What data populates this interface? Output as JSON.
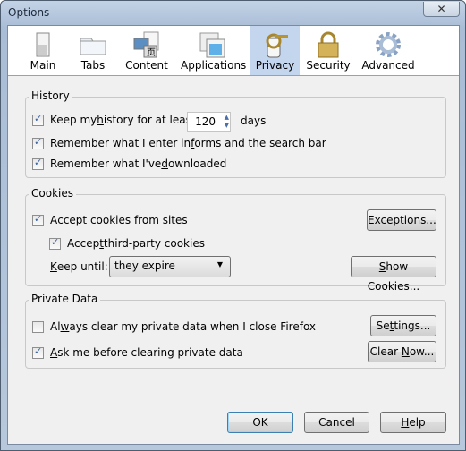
{
  "window": {
    "title": "Options",
    "close_icon": "close-icon"
  },
  "toolbar": {
    "items": [
      {
        "label": "Main",
        "icon": "switch-icon"
      },
      {
        "label": "Tabs",
        "icon": "folder-tabs-icon"
      },
      {
        "label": "Content",
        "icon": "content-icon"
      },
      {
        "label": "Applications",
        "icon": "applications-icon"
      },
      {
        "label": "Privacy",
        "icon": "privacy-key-icon",
        "selected": true
      },
      {
        "label": "Security",
        "icon": "padlock-icon"
      },
      {
        "label": "Advanced",
        "icon": "gear-icon"
      }
    ]
  },
  "history": {
    "title": "History",
    "keep_pre": "Keep my ",
    "keep_u": "h",
    "keep_post": "istory for at least",
    "days_value": "120",
    "days_label": "days",
    "keep_checked": true,
    "forms_pre": "Remember what I enter in ",
    "forms_u": "f",
    "forms_post": "orms and the search bar",
    "forms_checked": true,
    "dl_pre": "Remember what I've ",
    "dl_u": "d",
    "dl_post": "ownloaded",
    "dl_checked": true
  },
  "cookies": {
    "title": "Cookies",
    "accept_pre": "A",
    "accept_u": "c",
    "accept_post": "cept cookies from sites",
    "accept_checked": true,
    "third_pre": "Accep",
    "third_u": "t",
    "third_post": " third-party cookies",
    "third_checked": true,
    "keep_u": "K",
    "keep_post": "eep until:",
    "keep_value": "they expire",
    "exceptions_u": "E",
    "exceptions_post": "xceptions...",
    "show_pre": "",
    "show_u": "S",
    "show_post": "how Cookies..."
  },
  "private": {
    "title": "Private Data",
    "always_pre": "Al",
    "always_u": "w",
    "always_post": "ays clear my private data when I close Firefox",
    "always_checked": false,
    "ask_pre": "",
    "ask_u": "A",
    "ask_post": "sk me before clearing private data",
    "ask_checked": true,
    "settings_pre": "Se",
    "settings_u": "t",
    "settings_post": "tings...",
    "clear_pre": "Clear ",
    "clear_u": "N",
    "clear_post": "ow..."
  },
  "footer": {
    "ok": "OK",
    "cancel": "Cancel",
    "help_u": "H",
    "help_post": "elp"
  }
}
